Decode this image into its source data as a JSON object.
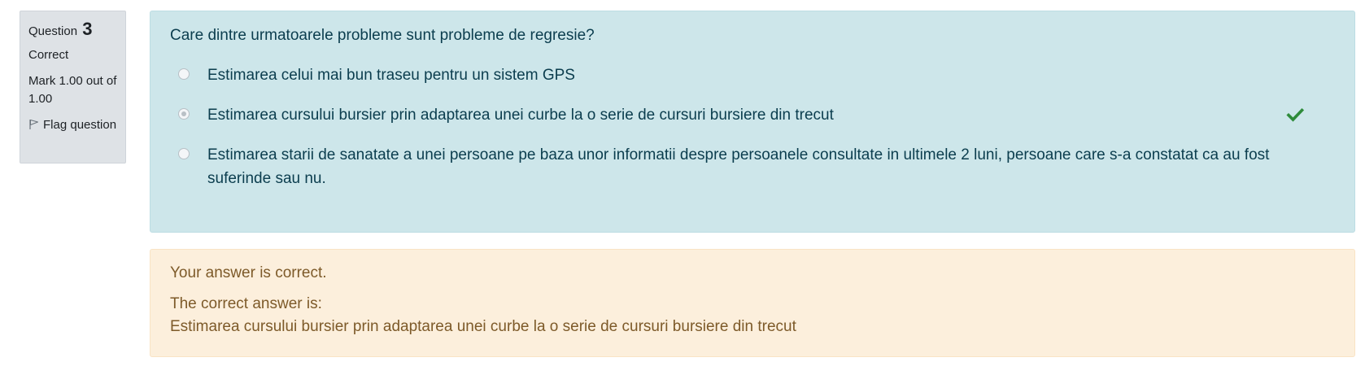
{
  "question_info": {
    "question_label": "Question",
    "question_number": "3",
    "state": "Correct",
    "grade": "Mark 1.00 out of 1.00",
    "flag_label": "Flag question"
  },
  "formulation": {
    "question_text": "Care dintre urmatoarele probleme sunt probleme de regresie?",
    "options": [
      {
        "label": "Estimarea celui mai bun traseu pentru un sistem GPS",
        "selected": false,
        "correct": false
      },
      {
        "label": "Estimarea cursului bursier prin adaptarea unei curbe la o serie de cursuri bursiere din trecut",
        "selected": true,
        "correct": true
      },
      {
        "label": "Estimarea starii de sanatate a unei persoane pe baza unor informatii despre persoanele consultate in ultimele 2 luni, persoane care s-a constatat ca au fost suferinde sau nu.",
        "selected": false,
        "correct": false
      }
    ],
    "correct_icon": "check-icon"
  },
  "outcome": {
    "feedback": "Your answer is correct.",
    "right_answer_label": "The correct answer is:",
    "right_answer": "Estimarea cursului bursier prin adaptarea unei curbe la o serie de cursuri bursiere din trecut"
  },
  "colors": {
    "formulation_bg": "#cde6ea",
    "outcome_bg": "#fcefdc",
    "info_bg": "#dee2e6",
    "check_green": "#2e8b3a"
  }
}
